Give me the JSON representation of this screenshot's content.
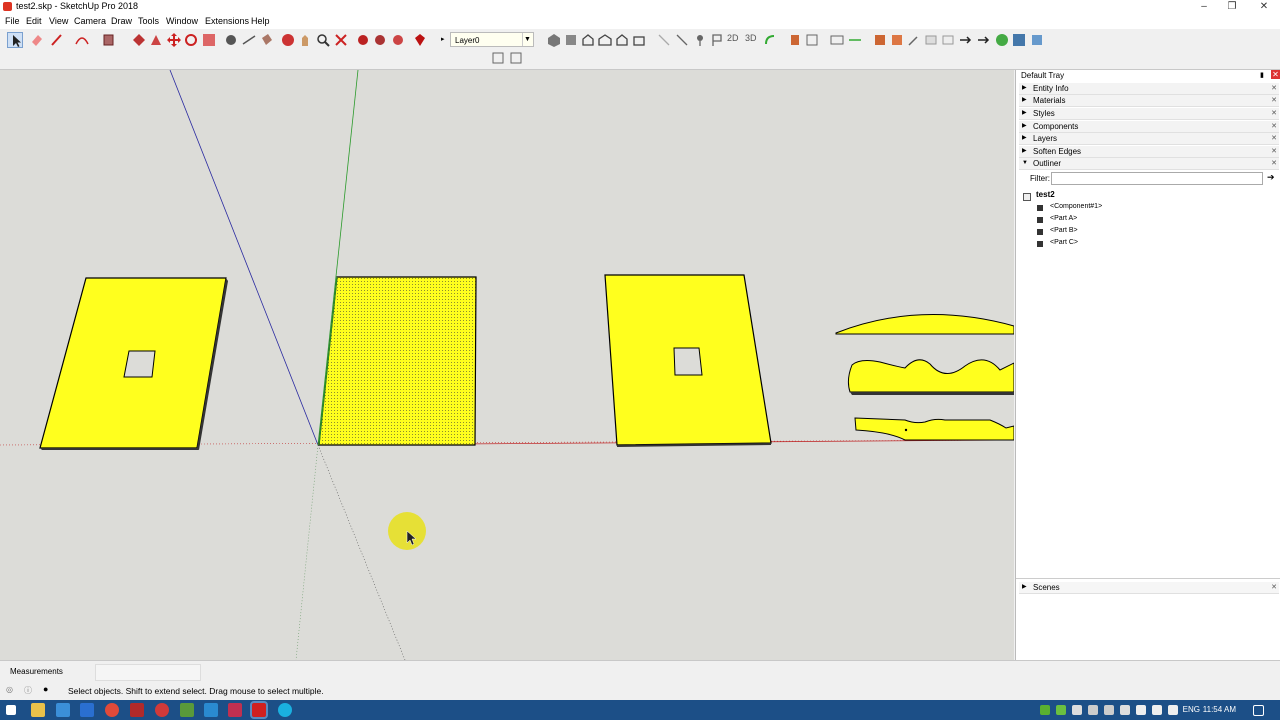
{
  "window": {
    "title": "test2.skp - SketchUp Pro 2018",
    "minimize": "–",
    "maximize": "❐",
    "close": "✕"
  },
  "menu": [
    "File",
    "Edit",
    "View",
    "Camera",
    "Draw",
    "Tools",
    "Window",
    "Extensions",
    "Help"
  ],
  "toolbar": {
    "layer_value": "Layer0",
    "view_2d": "2D",
    "view_3d": "3D"
  },
  "tray": {
    "title": "Default Tray",
    "panels": [
      {
        "label": "Entity Info",
        "expanded": false
      },
      {
        "label": "Materials",
        "expanded": false
      },
      {
        "label": "Styles",
        "expanded": false
      },
      {
        "label": "Components",
        "expanded": false
      },
      {
        "label": "Layers",
        "expanded": false
      },
      {
        "label": "Soften Edges",
        "expanded": false
      },
      {
        "label": "Outliner",
        "expanded": true
      }
    ],
    "filter_label": "Filter:",
    "filter_value": "",
    "outliner": {
      "root": "test2",
      "children": [
        "<Component#1>",
        "<Part A>",
        "<Part B>",
        "<Part C>"
      ]
    },
    "scenes": "Scenes"
  },
  "measurements_label": "Measurements",
  "status_text": "Select objects. Shift to extend select. Drag mouse to select multiple.",
  "taskbar": {
    "lang": "ENG",
    "time": "11:54 AM"
  },
  "colors": {
    "part_fill": "#ffff1e",
    "viewport_bg": "#dcdcd8",
    "taskbar": "#1c4f87",
    "cursor_highlight": "#e8e01a"
  }
}
